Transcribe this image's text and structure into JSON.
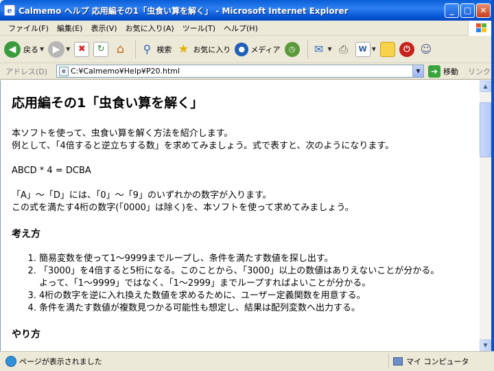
{
  "window": {
    "title": "Calmemo ヘルプ 応用編その1「虫食い算を解く」 - Microsoft Internet Explorer",
    "min_label": "_",
    "max_label": "□",
    "close_label": "✕"
  },
  "menu": [
    "ファイル(F)",
    "編集(E)",
    "表示(V)",
    "お気に入り(A)",
    "ツール(T)",
    "ヘルプ(H)"
  ],
  "toolbar": {
    "back_label": "戻る",
    "search_label": "検索",
    "favorites_label": "お気に入り",
    "media_label": "メディア"
  },
  "address": {
    "label": "アドレス(D)",
    "value": "C:¥Calmemo¥Help¥P20.html",
    "go_label": "移動",
    "links_label": "リンク"
  },
  "content": {
    "heading": "応用編その1「虫食い算を解く」",
    "intro1": "本ソフトを使って、虫食い算を解く方法を紹介します。",
    "intro2": "例として、「4倍すると逆立ちする数」を求めてみましょう。式で表すと、次のようになります。",
    "formula": "ABCD * 4 = DCBA",
    "desc1": "「A」〜「D」には、「0」〜「9」のいずれかの数字が入ります。",
    "desc2": "この式を満たす4桁の数字(「0000」は除く)を、本ソフトを使って求めてみましょう。",
    "section1": "考え方",
    "steps": [
      "簡易変数を使って1〜9999までループし、条件を満たす数値を探し出す。",
      "「3000」を4倍すると5桁になる。このことから、「3000」以上の数値はありえないことが分かる。",
      "よって、「1〜9999」ではなく、「1〜2999」までループすればよいことが分かる。",
      "4桁の数字を逆に入れ換えた数値を求めるために、ユーザー定義関数を用意する。",
      "条件を満たす数値が複数見つかる可能性も想定し、結果は配列変数へ出力する。"
    ],
    "section2": "やり方"
  },
  "status": {
    "text": "ページが表示されました",
    "zone": "マイ コンピュータ"
  }
}
